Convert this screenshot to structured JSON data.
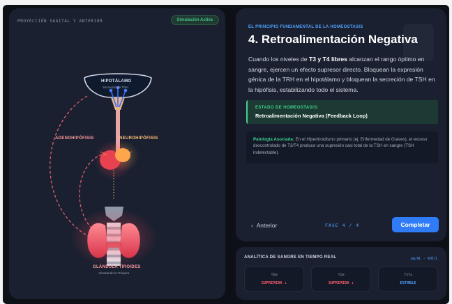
{
  "left_panel": {
    "projection_label": "PROYECCIÓN SAGITAL Y ANTERIOR",
    "simulation_badge": "Simulación Activa",
    "labels": {
      "hipotalamo": "HIPOTÁLAMO",
      "hipotalamo_sub": "Secreción de TRH",
      "adenohipofisis": "ADENOHIPÓFISIS",
      "neurohipofisis": "NEUROHIPÓFISIS",
      "tiroides": "GLÁNDULA TIROIDES",
      "tiroides_sub": "Abrazando la Tráquea"
    }
  },
  "step": {
    "eyebrow": "EL PRINCIPIO FUNDAMENTAL DE LA HOMEOSTASIS",
    "title": "4. Retroalimentación Negativa",
    "body_pre": "Cuando los niveles de ",
    "body_bold": "T3 y T4 libres",
    "body_post": " alcanzan el rango óptimo en sangre, ejercen un efecto supresor directo. Bloquean la expresión génica de la TRH en el hipotálamo y bloquean la secreción de TSH en la hipófisis, estabilizando todo el sistema.",
    "status_label": "ESTADO DE HOMEOSTASIS:",
    "status_value": "Retroalimentación Negativa (Feedback Loop)",
    "pathology_label": "Patología Asociada:",
    "pathology_pre": " En el ",
    "pathology_italic": "Hipertiroidismo",
    "pathology_post": " primario (ej. Enfermedad de Graves), el exceso descontrolado de T3/T4 produce una supresión casi total de la TSH en sangre (TSH indetectable)."
  },
  "navigation": {
    "back_label": "Anterior",
    "back_icon": "chevron-left",
    "phase_label": "FASE 4 / 4",
    "complete_label": "Completar"
  },
  "analytics": {
    "title": "ANALÍTICA DE SANGRE EN TIEMPO REAL",
    "units": "pg/mL - mUI/L",
    "cards": [
      {
        "name": "TRH",
        "value": "SUPRIMIDA ↓",
        "color": "#ff5d6c"
      },
      {
        "name": "TSH",
        "value": "SUPRIMIDA ↓",
        "color": "#ff5d6c"
      },
      {
        "name": "T3T4",
        "value": "ESTABLE",
        "color": "#4da3ff"
      }
    ]
  },
  "colors": {
    "accent_blue": "#2f7cf6",
    "accent_green": "#3fcf8e",
    "alert_red": "#ff5d6c",
    "panel_bg": "#1b2030"
  }
}
